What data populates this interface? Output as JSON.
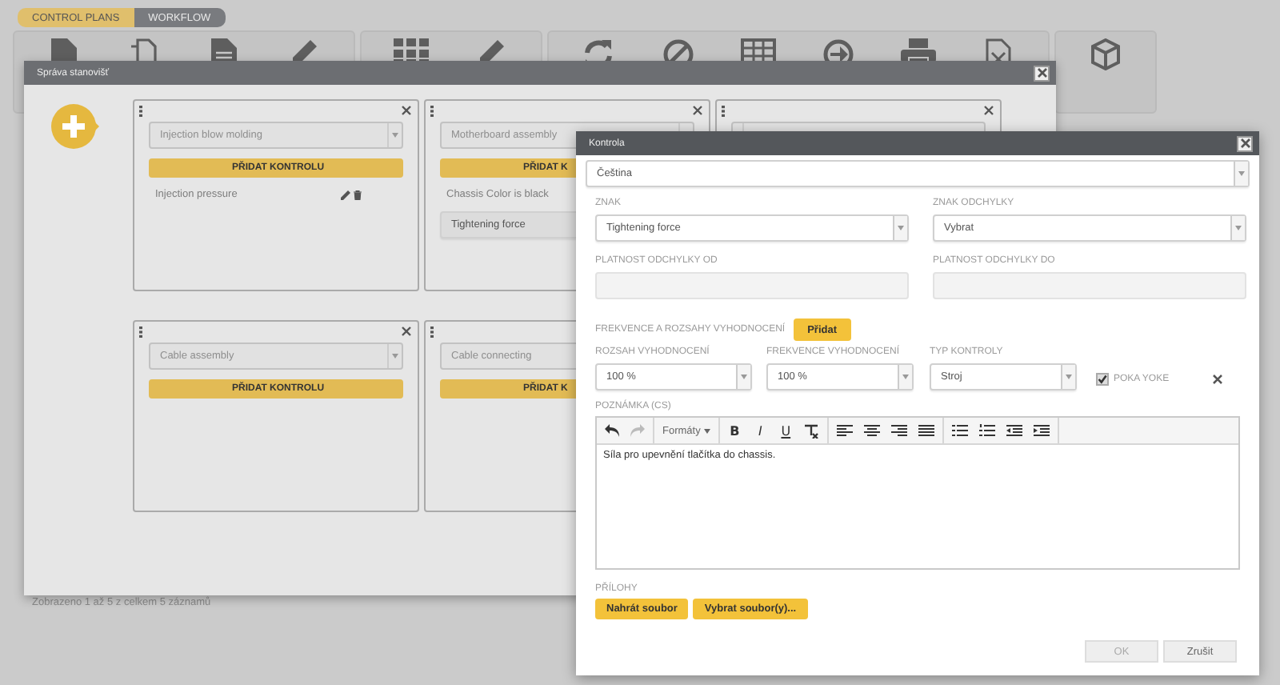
{
  "tabs": [
    {
      "label": "CONTROL PLANS",
      "selected": true
    },
    {
      "label": "WORKFLOW",
      "selected": false
    }
  ],
  "status_text": "Zobrazeno 1 až 5 z celkem 5 záznamů",
  "station_dialog": {
    "title": "Správa stanovišť",
    "cards": [
      {
        "kind": "full",
        "select": "Injection blow molding",
        "button": "PŘIDAT KONTROLU",
        "items": [
          {
            "label": "Injection pressure",
            "selected": false,
            "actions": true
          }
        ]
      },
      {
        "kind": "full",
        "select": "Motherboard assembly",
        "button": "PŘIDAT K",
        "items": [
          {
            "label": "Chassis Color is black",
            "selected": false
          },
          {
            "label": "Tightening force",
            "selected": true
          }
        ]
      },
      {
        "kind": "covered"
      },
      {
        "kind": "full",
        "select": "Cable assembly",
        "button": "PŘIDAT KONTROLU"
      },
      {
        "kind": "clipped",
        "select": "Cable connecting",
        "button": "PŘIDAT K"
      }
    ]
  },
  "control_dialog": {
    "title": "Kontrola",
    "language": "Čeština",
    "fields": [
      {
        "label": "ZNAK",
        "kind": "select",
        "value": "Tightening force"
      },
      {
        "label": "ZNAK ODCHYLKY",
        "kind": "select",
        "value": "Vybrat"
      },
      {
        "label": "PLATNOST ODCHYLKY OD",
        "kind": "input"
      },
      {
        "label": "PLATNOST ODCHYLKY DO",
        "kind": "input"
      }
    ],
    "frequency_label": "FREKVENCE A ROZSAHY VYHODNOCENÍ",
    "add_button": "Přidat",
    "evaluation": [
      {
        "label": "ROZSAH VYHODNOCENÍ",
        "value": "100 %"
      },
      {
        "label": "FREKVENCE VYHODNOCENÍ",
        "value": "100 %"
      },
      {
        "label": "TYP KONTROLY",
        "value": "Stroj"
      }
    ],
    "poka_yoke": {
      "label": "POKA YOKE",
      "checked": true
    },
    "note_label": "POZNÁMKA (CS)",
    "editor": {
      "formats": "Formáty",
      "format_buttons": [
        "B",
        "I",
        "U"
      ],
      "text": "Síla pro upevnění tlačítka do chassis."
    },
    "attachments_label": "PŘÍLOHY",
    "attachment_buttons": [
      "Nahrát soubor",
      "Vybrat soubor(y)..."
    ],
    "buttons": [
      {
        "label": "OK",
        "disabled": true
      },
      {
        "label": "Zrušit",
        "disabled": false
      }
    ]
  }
}
